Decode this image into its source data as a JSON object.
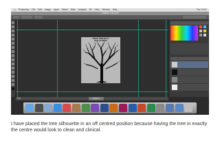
{
  "menubar": {
    "items": [
      "Photoshop",
      "File",
      "Edit",
      "Image",
      "Layer",
      "Select",
      "Filter",
      "Analysis",
      "3D",
      "View",
      "Window",
      "Help"
    ],
    "clock": "Thu 12:04"
  },
  "document": {
    "title": "Untitled-1 @ 50%",
    "artboard_label": "TREE PROJECT\nSOLUTIONS"
  },
  "status": {
    "zoom": "50%",
    "tab": "Untitled-1"
  },
  "dock": {
    "icons": [
      "finder-icon",
      "dashboard-icon",
      "mail-icon",
      "safari-icon",
      "ical-icon",
      "address-book-icon",
      "iphoto-icon",
      "itunes-icon",
      "photoshop-icon",
      "illustrator-icon",
      "indesign-icon",
      "word-icon",
      "powerpoint-icon",
      "excel-icon",
      "system-preferences-icon",
      "stack-icon",
      "downloads-icon",
      "trash-icon"
    ],
    "colors": [
      "#6aa7e0",
      "#4d4d4d",
      "#8aa8cf",
      "#3c8fe0",
      "#d94c4c",
      "#a57a4d",
      "#4d8f4d",
      "#7a4db3",
      "#2b4f8c",
      "#c96a1a",
      "#9b1a5a",
      "#2b5caa",
      "#c44a2a",
      "#2f8a4f",
      "#8a8a8a",
      "#5a7ab3",
      "#5b87c5",
      "#bdbdbd"
    ]
  },
  "colors": {
    "guide": "#1f8f73",
    "canvas": "#2e2e2e",
    "artboard": "#b9b9b9"
  },
  "caption": "I have placed the tree silhouette in an off centred position because having the tree in exactly the centre would look to clean and clinical."
}
